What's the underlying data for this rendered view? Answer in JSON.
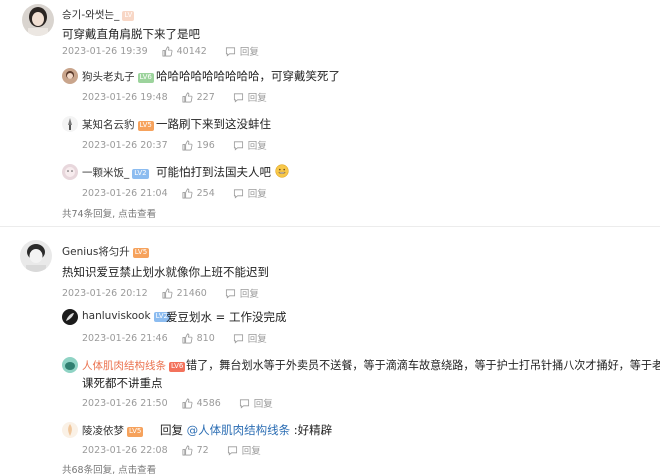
{
  "thread1": {
    "user": "승기-와썻는_",
    "text": "可穿戴直角肩脱下来了是吧",
    "date": "2023-01-26 19:39",
    "likes": "40142",
    "reply_label": "回复",
    "replies": [
      {
        "user": "狗头老丸子",
        "level": "LV6",
        "text": "哈哈哈哈哈哈哈哈哈，可穿戴笑死了",
        "date": "2023-01-26 19:48",
        "likes": "227",
        "reply_label": "回复"
      },
      {
        "user": "某知名云豹",
        "level": "LV5",
        "text": "一路刷下来到这没蚌住",
        "date": "2023-01-26 20:37",
        "likes": "196",
        "reply_label": "回复"
      },
      {
        "user": "一颗米饭_",
        "level": "LV2",
        "text": "可能怕打到法国夫人吧",
        "date": "2023-01-26 21:04",
        "likes": "254",
        "reply_label": "回复"
      }
    ],
    "total": "共74条回复, 点击查看"
  },
  "thread2": {
    "user": "Genius将匀升",
    "level": "LV5",
    "text": "热知识爱豆禁止划水就像你上班不能迟到",
    "date": "2023-01-26 20:12",
    "likes": "21460",
    "reply_label": "回复",
    "replies": [
      {
        "user": "hanluviskook",
        "level": "LV2",
        "text": "爱豆划水 = 工作没完成",
        "date": "2023-01-26 21:46",
        "likes": "810",
        "reply_label": "回复"
      },
      {
        "user": "人体肌肉结构线条",
        "level": "LV6",
        "text_line1": "错了，舞台划水等于外卖员不送餐，等于滴滴车故意绕路，等于护士打吊针捅八次才捅好，等于老师讲",
        "text_line2": "课死都不讲重点",
        "date": "2023-01-26 21:50",
        "likes": "4586",
        "reply_label": "回复"
      },
      {
        "user": "陵凌依梦",
        "level": "LV5",
        "text_prefix": "回复 ",
        "mention": "@人体肌肉结构线条",
        "text_suffix": " :好精辟",
        "date": "2023-01-26 22:08",
        "likes": "72",
        "reply_label": "回复"
      }
    ],
    "total": "共68条回复, 点击查看"
  },
  "icons": {
    "like": "thumb-up-icon",
    "reply": "comment-bubble-icon",
    "emoji": "grin-emoji-icon"
  },
  "colors": {
    "username_highlight": "#eb7350",
    "mention": "#2b6db3",
    "meta": "#9a9a9a"
  }
}
